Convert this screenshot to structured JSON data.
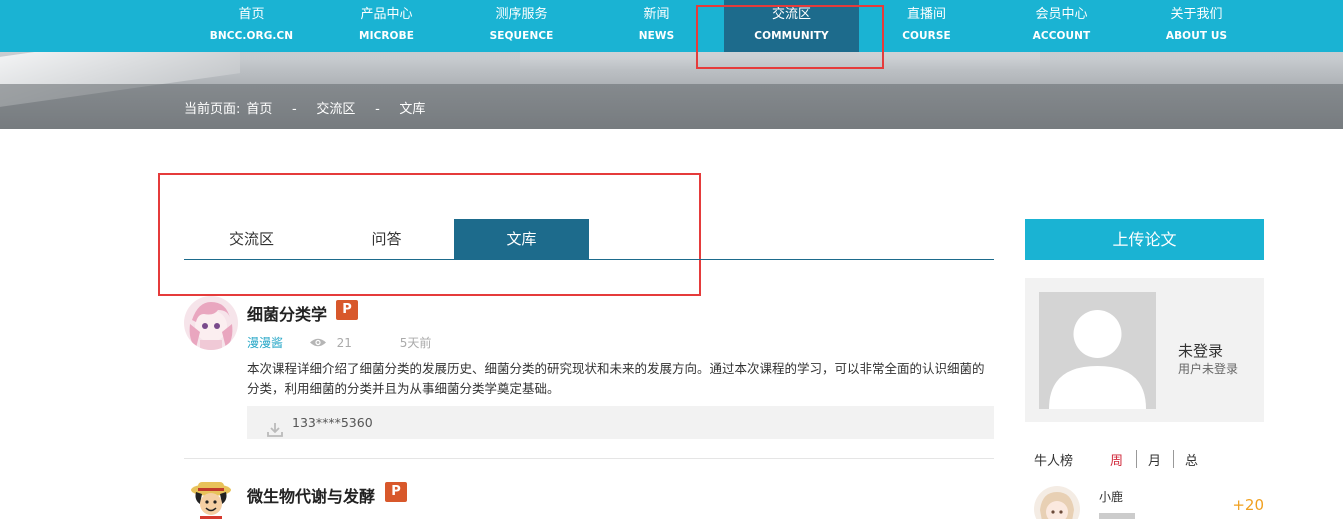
{
  "nav": [
    {
      "cn": "首页",
      "en": "BNCC.ORG.CN"
    },
    {
      "cn": "产品中心",
      "en": "MICROBE"
    },
    {
      "cn": "测序服务",
      "en": "SEQUENCE"
    },
    {
      "cn": "新闻",
      "en": "NEWS"
    },
    {
      "cn": "交流区",
      "en": "COMMUNITY"
    },
    {
      "cn": "直播间",
      "en": "COURSE"
    },
    {
      "cn": "会员中心",
      "en": "ACCOUNT"
    },
    {
      "cn": "关于我们",
      "en": "ABOUT US"
    }
  ],
  "nav_active_index": 4,
  "breadcrumb": {
    "label": "当前页面:",
    "items": [
      "首页",
      "交流区",
      "文库"
    ],
    "separator": "-"
  },
  "tabs": [
    "交流区",
    "问答",
    "文库"
  ],
  "active_tab": "文库",
  "articles": [
    {
      "title": "细菌分类学",
      "file_icon": "P",
      "author": "漫漫酱",
      "views": "21",
      "time": "5天前",
      "description": "本次课程详细介绍了细菌分类的发展历史、细菌分类的研究现状和未来的发展方向。通过本次课程的学习，可以非常全面的认识细菌的分类，利用细菌的分类并且为从事细菌分类学奠定基础。",
      "downloader": "133****5360"
    },
    {
      "title": "微生物代谢与发酵",
      "file_icon": "P"
    }
  ],
  "sidebar": {
    "upload_label": "上传论文",
    "user_name": "未登录",
    "user_status": "用户未登录",
    "rank_title": "牛人榜",
    "rank_tabs": [
      "周",
      "月",
      "总"
    ],
    "rank_active": "周",
    "rank_list": [
      {
        "name": "小鹿",
        "score": "+20"
      }
    ]
  },
  "colors": {
    "nav_bg": "#1ab3d3",
    "active_bg": "#1d6b8c",
    "highlight_box": "#e53b3b",
    "author_link": "#2aa8c8",
    "score": "#f0a020",
    "rank_active": "#d0283a",
    "ppt_icon": "#d8582b"
  }
}
